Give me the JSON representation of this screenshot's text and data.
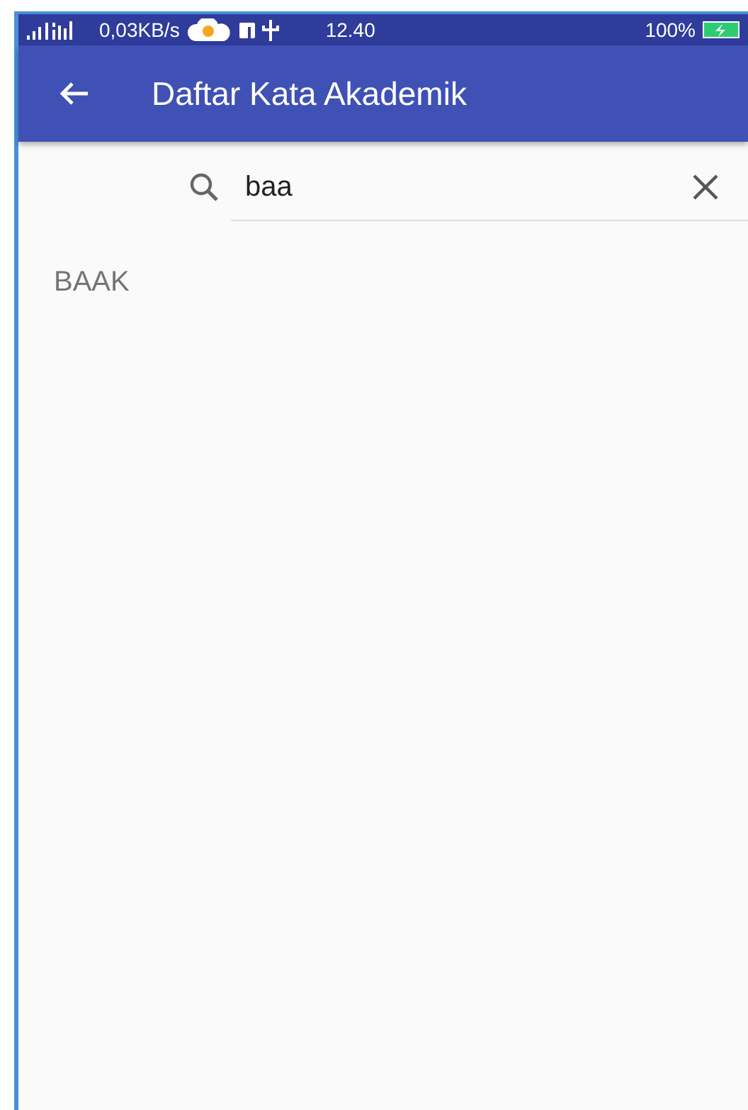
{
  "status_bar": {
    "network_speed": "0,03KB/s",
    "time": "12.40",
    "battery": "100%",
    "charging": true
  },
  "app_bar": {
    "title": "Daftar Kata Akademik"
  },
  "search": {
    "value": "baa"
  },
  "results": [
    {
      "label": "BAAK"
    }
  ]
}
